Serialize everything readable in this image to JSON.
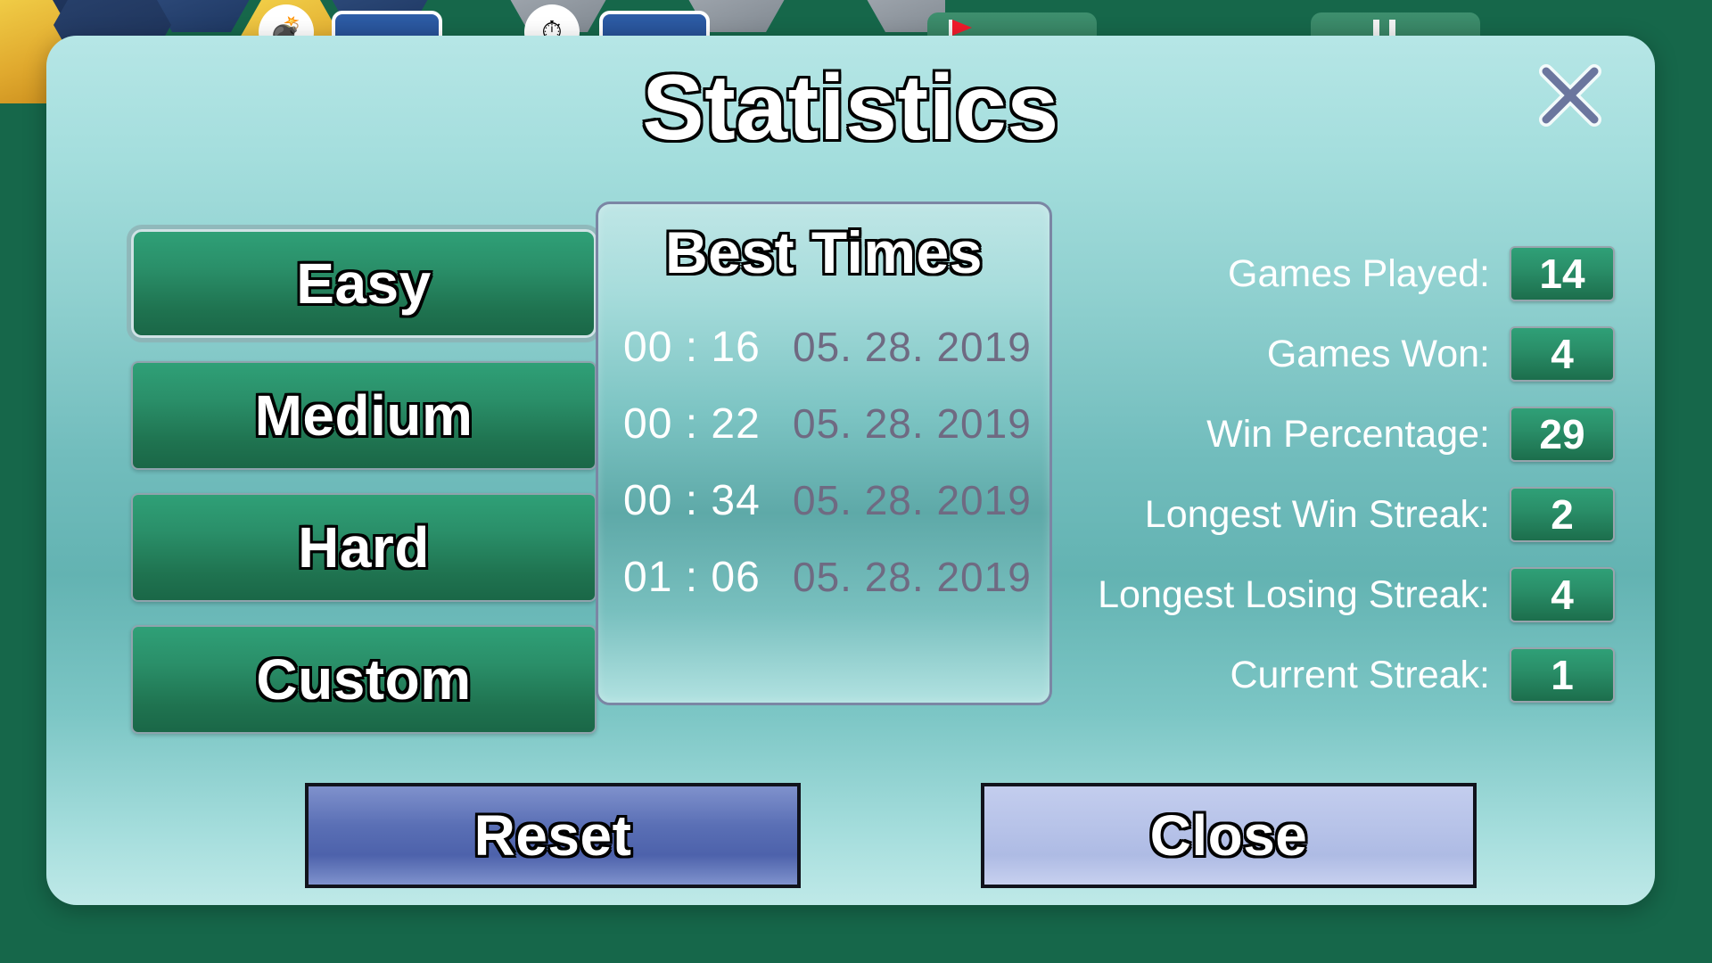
{
  "background": {
    "board_name": "hexagonal-minesweeper-board",
    "toolbar": {
      "mine_counter_icon": "bomb-icon",
      "timer_icon": "stopwatch-icon",
      "flag_icon": "flag-icon",
      "pause_icon": "pause-icon"
    }
  },
  "dialog": {
    "title": "Statistics",
    "close_icon": "close-x-icon"
  },
  "difficulty": {
    "selected": "Easy",
    "options": [
      {
        "label": "Easy",
        "selected": true
      },
      {
        "label": "Medium",
        "selected": false
      },
      {
        "label": "Hard",
        "selected": false
      },
      {
        "label": "Custom",
        "selected": false
      }
    ]
  },
  "best_times": {
    "title": "Best Times",
    "rows": [
      {
        "time": "00 : 16",
        "date": "05. 28. 2019"
      },
      {
        "time": "00 : 22",
        "date": "05. 28. 2019"
      },
      {
        "time": "00 : 34",
        "date": "05. 28. 2019"
      },
      {
        "time": "01 : 06",
        "date": "05. 28. 2019"
      }
    ]
  },
  "stats": {
    "rows": [
      {
        "label": "Games Played:",
        "value": "14"
      },
      {
        "label": "Games Won:",
        "value": "4"
      },
      {
        "label": "Win Percentage:",
        "value": "29"
      },
      {
        "label": "Longest Win Streak:",
        "value": "2"
      },
      {
        "label": "Longest Losing Streak:",
        "value": "4"
      },
      {
        "label": "Current Streak:",
        "value": "1"
      }
    ]
  },
  "actions": {
    "reset_label": "Reset",
    "close_label": "Close"
  },
  "colors": {
    "page_background": "#16674a",
    "dialog_top": "#b6e6e6",
    "dialog_mid": "#63b3b2",
    "button_green": "#2a8f69",
    "reset_blue": "#5a6fb5",
    "close_lavender": "#b6c2e8",
    "date_text": "#6f6a82",
    "close_x": "#6b769e"
  }
}
